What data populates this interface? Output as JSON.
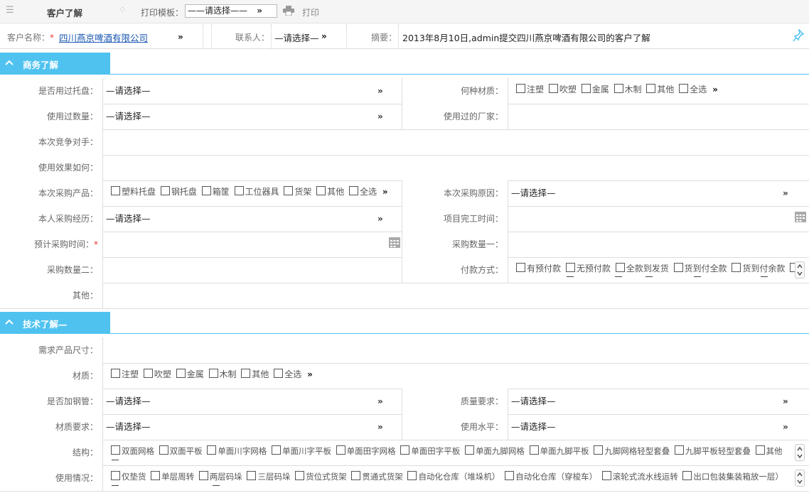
{
  "toolbar": {
    "title": "客户了解",
    "print_template_label": "打印模板：",
    "print_template_value": "——请选择——",
    "print_label": "打印"
  },
  "header": {
    "customer_label": "客户名称：",
    "customer_value": "四川燕京啤酒有限公司",
    "contact_label": "联系人：",
    "contact_value": "—请选择—",
    "summary_label": "摘要：",
    "summary_value": "2013年8月10日,admin提交四川燕京啤酒有限公司的客户了解"
  },
  "sections": {
    "business": "商务了解",
    "tech": "技术了解—"
  },
  "business": {
    "pallet_used_label": "是否用过托盘：",
    "pallet_used_value": "—请选择—",
    "material_label": "何种材质：",
    "material_options": [
      "注塑",
      "吹塑",
      "金属",
      "木制",
      "其他",
      "全选"
    ],
    "qty_used_label": "使用过数量：",
    "qty_used_value": "—请选择—",
    "vendor_label": "使用过的厂家：",
    "competitor_label": "本次竞争对手：",
    "effect_label": "使用效果如何：",
    "product_label": "本次采购产品：",
    "product_options": [
      "塑料托盘",
      "钢托盘",
      "箱筐",
      "工位器具",
      "货架",
      "其他",
      "全选"
    ],
    "reason_label": "本次采购原因：",
    "reason_value": "—请选择—",
    "experience_label": "本人采购经历：",
    "experience_value": "—请选择—",
    "finish_label": "项目完工时间：",
    "expected_label": "预计采购时间：",
    "qty1_label": "采购数量一：",
    "qty2_label": "采购数量二：",
    "payment_label": "付款方式：",
    "payment_options": [
      "有预付款",
      "无预付款",
      "全款到发货",
      "货到付全款",
      "货到付余款"
    ],
    "other_label": "其他："
  },
  "tech": {
    "size_label": "需求产品尺寸：",
    "material_label": "材质：",
    "material_options": [
      "注塑",
      "吹塑",
      "金属",
      "木制",
      "其他",
      "全选"
    ],
    "steel_label": "是否加钢管：",
    "steel_value": "—请选择—",
    "quality_label": "质量要求：",
    "quality_value": "—请选择—",
    "matreq_label": "材质要求：",
    "matreq_value": "—请选择—",
    "level_label": "使用水平：",
    "level_value": "—请选择—",
    "structure_label": "结构：",
    "structure_options": [
      "双面网格",
      "双面平板",
      "单面川字网格",
      "单面川字平板",
      "单面田字网格",
      "单面田字平板",
      "单面九脚网格",
      "单面九脚平板",
      "九脚网格轻型套叠",
      "九脚平板轻型套叠",
      "其他"
    ],
    "usage_label": "使用情况：",
    "usage_options": [
      "仅垫货",
      "单层周转",
      "两层码垛",
      "三层码垛",
      "货位式货架",
      "贯通式货架",
      "自动化仓库（堆垛机）",
      "自动化仓库（穿梭车）",
      "滚轮式流水线运转",
      "出口包装集装箱放一层）"
    ]
  },
  "colors": {
    "accent": "#4fc2f0",
    "link": "#1a57b2",
    "required": "#e33333"
  }
}
